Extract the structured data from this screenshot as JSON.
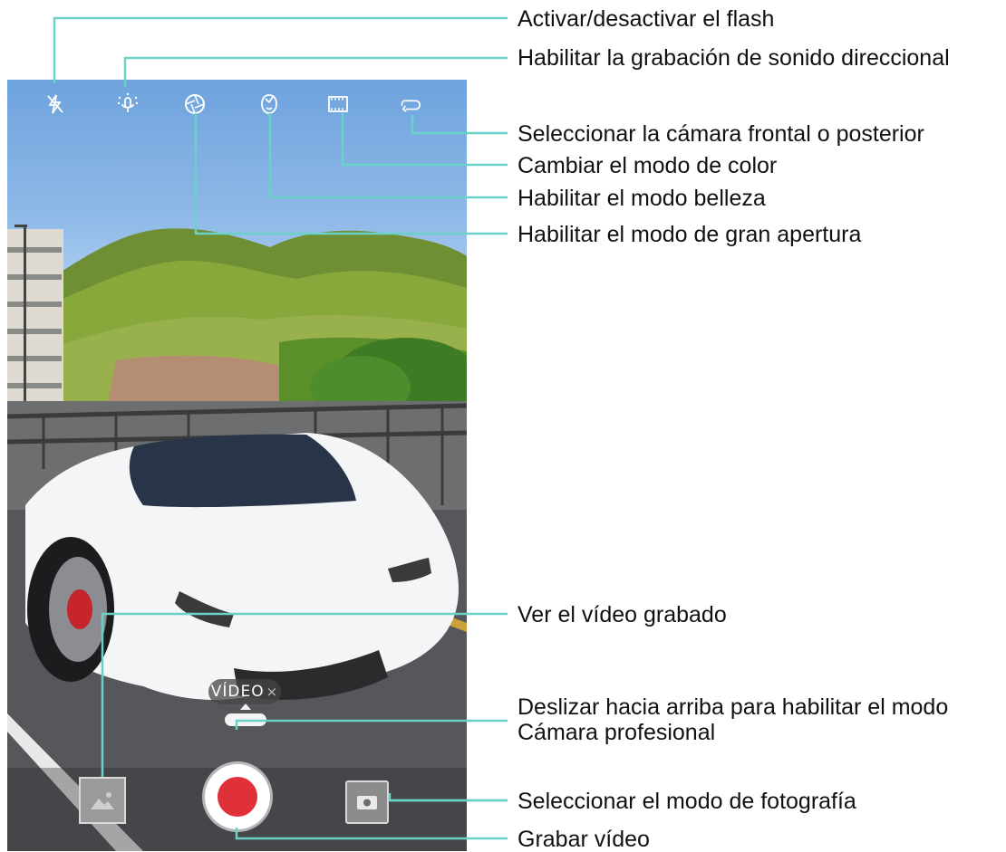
{
  "viewfinder": {
    "mode_label": "VÍDEO",
    "mode_close": "×"
  },
  "top_icons": [
    "flash-off-icon",
    "directional-mic-icon",
    "aperture-icon",
    "beauty-icon",
    "color-mode-film-icon",
    "switch-camera-icon"
  ],
  "callouts": {
    "flash": "Activar/desactivar el flash",
    "directional_audio": "Habilitar la grabación de sonido direccional",
    "switch_camera": "Seleccionar la cámara frontal o posterior",
    "color_mode": "Cambiar el modo de color",
    "beauty": "Habilitar el modo belleza",
    "aperture": "Habilitar el modo de gran apertura",
    "gallery": "Ver el vídeo grabado",
    "pro_mode_line1": "Deslizar hacia arriba para habilitar el modo",
    "pro_mode_line2": "Cámara profesional",
    "photo_mode": "Seleccionar el modo de fotografía",
    "record": "Grabar vídeo"
  },
  "colors": {
    "record_red": "#e03138",
    "callout_line": "#6ad1c8"
  }
}
